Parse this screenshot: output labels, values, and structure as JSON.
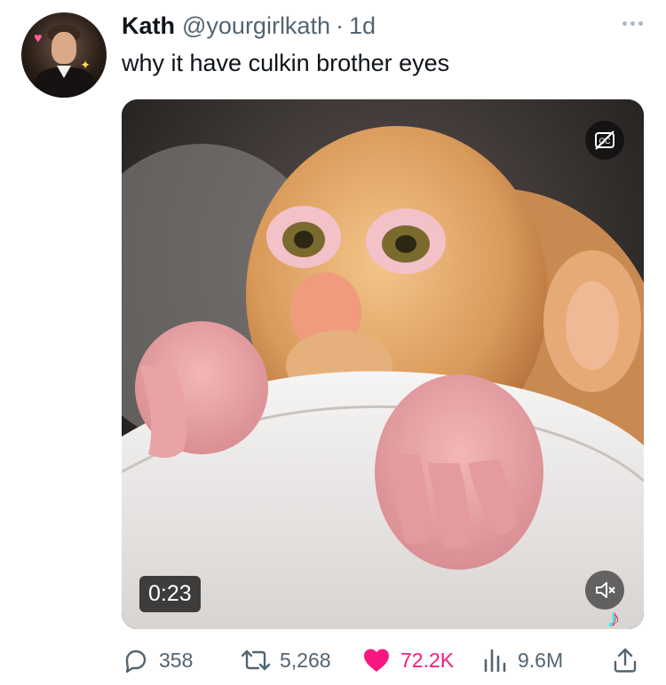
{
  "tweet": {
    "author_name": "Kath",
    "author_handle": "@yourgirlkath",
    "separator": "·",
    "time": "1d",
    "text": "why it have culkin brother eyes",
    "avatar_icon": "avatar-photo",
    "more_icon": "more-horizontal-icon"
  },
  "media": {
    "type": "video",
    "duration": "0:23",
    "captions_icon": "closed-captions-off-icon",
    "mute_icon": "speaker-muted-icon",
    "watermark": "tiktok-logo"
  },
  "actions": {
    "replies": "358",
    "retweets": "5,268",
    "likes": "72.2K",
    "views": "9.6M",
    "like_color": "#f91880",
    "muted_color": "#536471"
  },
  "colors": {
    "text": "#0f1419",
    "secondary": "#536471",
    "background": "#ffffff"
  }
}
